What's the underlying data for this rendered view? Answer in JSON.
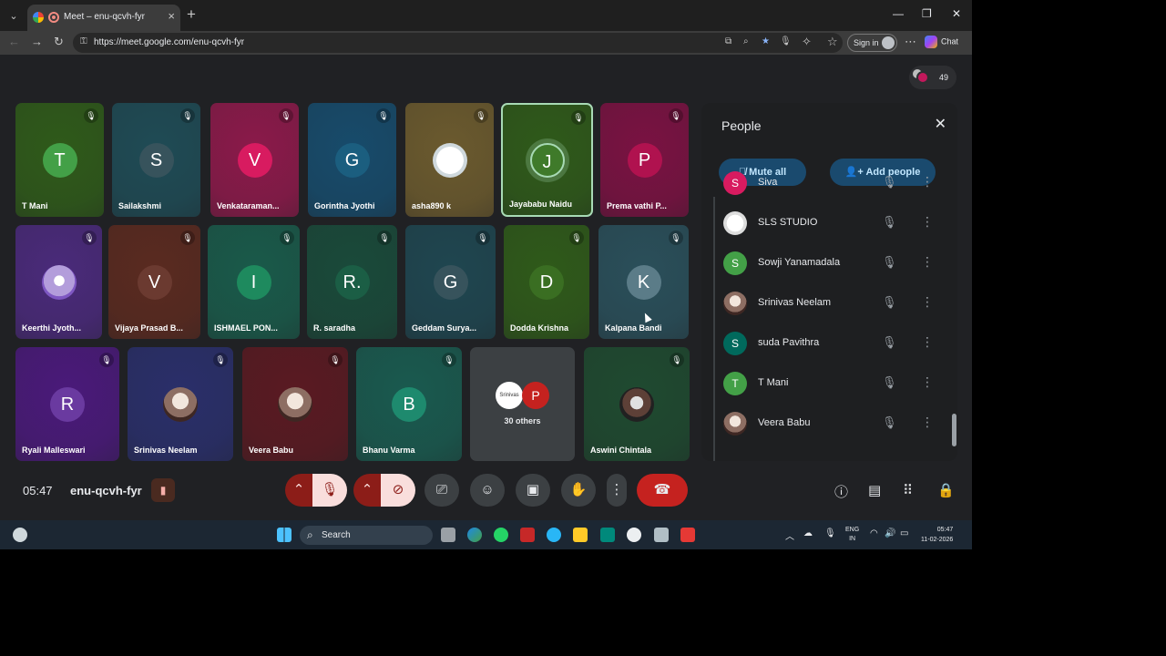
{
  "browser": {
    "tab_title": "Meet – enu-qcvh-fyr",
    "url": "https://meet.google.com/enu-qcvh-fyr",
    "signin_label": "Sign in",
    "chat_label": "Chat"
  },
  "meet": {
    "participant_count": "49",
    "time": "05:47",
    "meeting_code": "enu-qcvh-fyr",
    "others_label": "30 others",
    "tiles": [
      {
        "name": "T Mani",
        "initial": "T",
        "bg": "#2f5a1a",
        "av": "#43a047"
      },
      {
        "name": "Sailakshmi",
        "initial": "S",
        "bg": "#1f4b55",
        "av": "#37535c"
      },
      {
        "name": "Venkataraman...",
        "initial": "V",
        "bg": "#8b1a4a",
        "av": "#d81b60"
      },
      {
        "name": "Gorintha Jyothi",
        "initial": "G",
        "bg": "#174b6b",
        "av": "#1b5e7f"
      },
      {
        "name": "asha890 k",
        "initial": "",
        "bg": "#6b5a2e",
        "av": ""
      },
      {
        "name": "Jayababu Naidu",
        "initial": "J",
        "bg": "#2f5a1a",
        "av": "#3f7a2a"
      },
      {
        "name": "Prema vathi P...",
        "initial": "P",
        "bg": "#7a1242",
        "av": "#b0124f"
      },
      {
        "name": "Keerthi Jyoth...",
        "initial": "",
        "bg": "#4a2a7a",
        "av": ""
      },
      {
        "name": "Vijaya Prasad B...",
        "initial": "V",
        "bg": "#5a2a20",
        "av": "#6b3a30"
      },
      {
        "name": "ISHMAEL PON...",
        "initial": "I",
        "bg": "#1a5a4a",
        "av": "#1e8a5e"
      },
      {
        "name": "R. saradha",
        "initial": "R.",
        "bg": "#1a4a3a",
        "av": "#1b5e45"
      },
      {
        "name": "Geddam Surya...",
        "initial": "G",
        "bg": "#1f4650",
        "av": "#37535c"
      },
      {
        "name": "Dodda Krishna",
        "initial": "D",
        "bg": "#2f5a1a",
        "av": "#3a6e22"
      },
      {
        "name": "Kalpana Bandi",
        "initial": "K",
        "bg": "#2a4f5a",
        "av": "#5b7c88"
      },
      {
        "name": "Ryali Malleswari",
        "initial": "R",
        "bg": "#4a1a7a",
        "av": "#6a3aa0"
      },
      {
        "name": "Srinivas Neelam",
        "initial": "",
        "bg": "#2a2f6a",
        "av": ""
      },
      {
        "name": "Veera Babu",
        "initial": "",
        "bg": "#5a1a22",
        "av": ""
      },
      {
        "name": "Bhanu Varma",
        "initial": "B",
        "bg": "#1a5a4f",
        "av": "#1e8a6e"
      },
      {
        "name": "Aswini Chintala",
        "initial": "",
        "bg": "#1f4a30",
        "av": ""
      }
    ],
    "others_avatars": [
      {
        "initial": "Srinivas",
        "bg": "#ffffff"
      },
      {
        "initial": "P",
        "bg": "#c5221f"
      }
    ]
  },
  "people_panel": {
    "title": "People",
    "mute_all": "Mute all",
    "add_people": "Add people",
    "list": [
      {
        "name": "Siva",
        "initial": "S",
        "color": "#d81b60"
      },
      {
        "name": "SLS STUDIO",
        "initial": "",
        "color": "#ffffff"
      },
      {
        "name": "Sowji Yanamadala",
        "initial": "S",
        "color": "#43a047"
      },
      {
        "name": "Srinivas Neelam",
        "initial": "",
        "color": "#8d6e63"
      },
      {
        "name": "suda Pavithra",
        "initial": "S",
        "color": "#00695c"
      },
      {
        "name": "T Mani",
        "initial": "T",
        "color": "#43a047"
      },
      {
        "name": "Veera Babu",
        "initial": "",
        "color": "#8d6e63"
      }
    ]
  },
  "taskbar": {
    "search_placeholder": "Search",
    "lang_top": "ENG",
    "lang_bottom": "IN",
    "clock_time": "05:47",
    "clock_date": "11-02-2026"
  },
  "icons": {
    "mic_off": "mic-off-icon",
    "cam_off": "camera-off-icon",
    "present": "present-icon",
    "emoji": "emoji-icon",
    "captions": "captions-icon",
    "hand": "raise-hand-icon",
    "more": "more-icon",
    "end_call": "end-call-icon"
  }
}
